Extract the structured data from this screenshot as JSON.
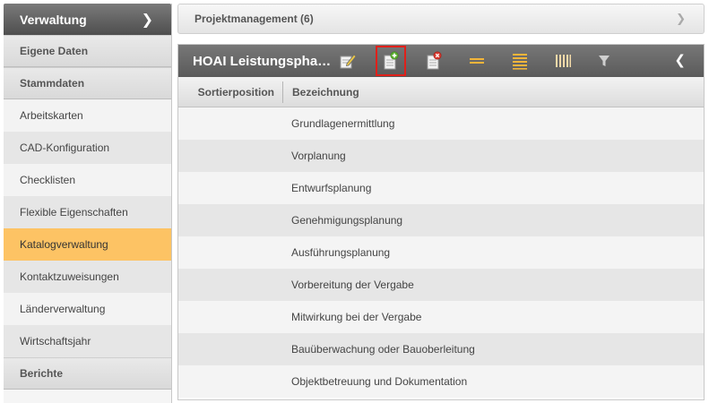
{
  "sidebar": {
    "header": {
      "title": "Verwaltung",
      "chevron_icon": "chevron-right-icon"
    },
    "sections": [
      {
        "label": "Eigene Daten"
      },
      {
        "label": "Stammdaten"
      }
    ],
    "items": [
      {
        "label": "Arbeitskarten"
      },
      {
        "label": "CAD-Konfiguration"
      },
      {
        "label": "Checklisten"
      },
      {
        "label": "Flexible Eigenschaften"
      },
      {
        "label": "Katalogverwaltung",
        "active": true
      },
      {
        "label": "Kontaktzuweisungen"
      },
      {
        "label": "Länderverwaltung"
      },
      {
        "label": "Wirtschaftsjahr"
      }
    ],
    "footer_section": {
      "label": "Berichte"
    }
  },
  "project_panel": {
    "title": "Projektmanagement (6)",
    "chevron_icon": "chevron-down-icon"
  },
  "main_panel": {
    "title": "HOAI Leistungspha…",
    "toolbar": [
      {
        "icon": "edit-icon"
      },
      {
        "icon": "add-document-icon",
        "selected": true
      },
      {
        "icon": "delete-document-icon"
      },
      {
        "icon": "row-spacing-compact-icon"
      },
      {
        "icon": "row-spacing-list-icon"
      },
      {
        "icon": "columns-icon"
      },
      {
        "icon": "filter-icon"
      }
    ],
    "collapse_icon": "chevron-up-icon",
    "columns": {
      "sort": "Sortierposition",
      "desc": "Bezeichnung"
    },
    "rows": [
      {
        "sort": "",
        "desc": "Grundlagenermittlung"
      },
      {
        "sort": "",
        "desc": "Vorplanung"
      },
      {
        "sort": "",
        "desc": "Entwurfsplanung"
      },
      {
        "sort": "",
        "desc": "Genehmigungsplanung"
      },
      {
        "sort": "",
        "desc": "Ausführungsplanung"
      },
      {
        "sort": "",
        "desc": "Vorbereitung der Vergabe"
      },
      {
        "sort": "",
        "desc": "Mitwirkung bei der Vergabe"
      },
      {
        "sort": "",
        "desc": "Bauüberwachung oder Bauoberleitung"
      },
      {
        "sort": "",
        "desc": "Objektbetreuung und Dokumentation"
      }
    ]
  },
  "colors": {
    "accent": "#fdc364",
    "selected_outline": "#e0201a",
    "header_dark": "#5a5a5a"
  }
}
